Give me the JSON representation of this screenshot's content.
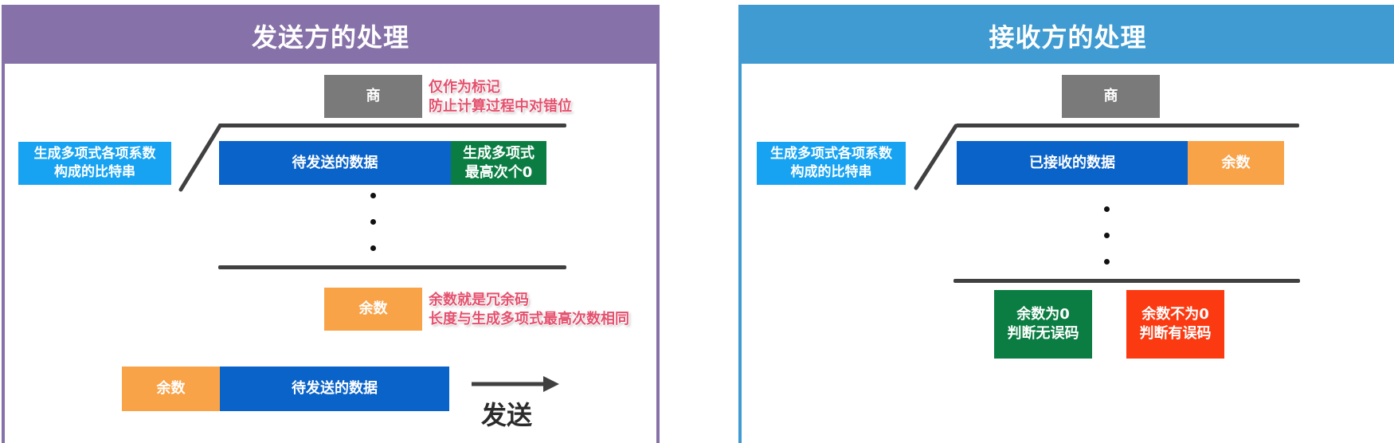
{
  "left": {
    "title": "发送方的处理",
    "quotient": "商",
    "quotient_note": [
      "仅作为标记",
      "防止计算过程中对错位"
    ],
    "divisor": [
      "生成多项式各项系数",
      "构成的比特串"
    ],
    "data_block": "待发送的数据",
    "padding_block": [
      "生成多项式",
      "最高次个0"
    ],
    "remainder": "余数",
    "remainder_note": [
      "余数就是冗余码",
      "长度与生成多项式最高次数相同"
    ],
    "frame_remainder": "余数",
    "frame_data": "待发送的数据",
    "send_label": "发送"
  },
  "right": {
    "title": "接收方的处理",
    "quotient": "商",
    "divisor": [
      "生成多项式各项系数",
      "构成的比特串"
    ],
    "data_block": "已接收的数据",
    "remainder_block": "余数",
    "result_ok": [
      "余数为0",
      "判断无误码"
    ],
    "result_err": [
      "余数不为0",
      "判断有误码"
    ]
  },
  "colors": {
    "left_header": "#8671a8",
    "right_header": "#3f9bd1",
    "data_blue": "#0a63c9",
    "zero_green": "#0b7d43",
    "remainder_orange": "#f9a349",
    "error_red": "#fb3a12",
    "divisor_cyan": "#18a3f2",
    "quotient_gray": "#7a7a7a",
    "note_pink": "#e4516e"
  }
}
